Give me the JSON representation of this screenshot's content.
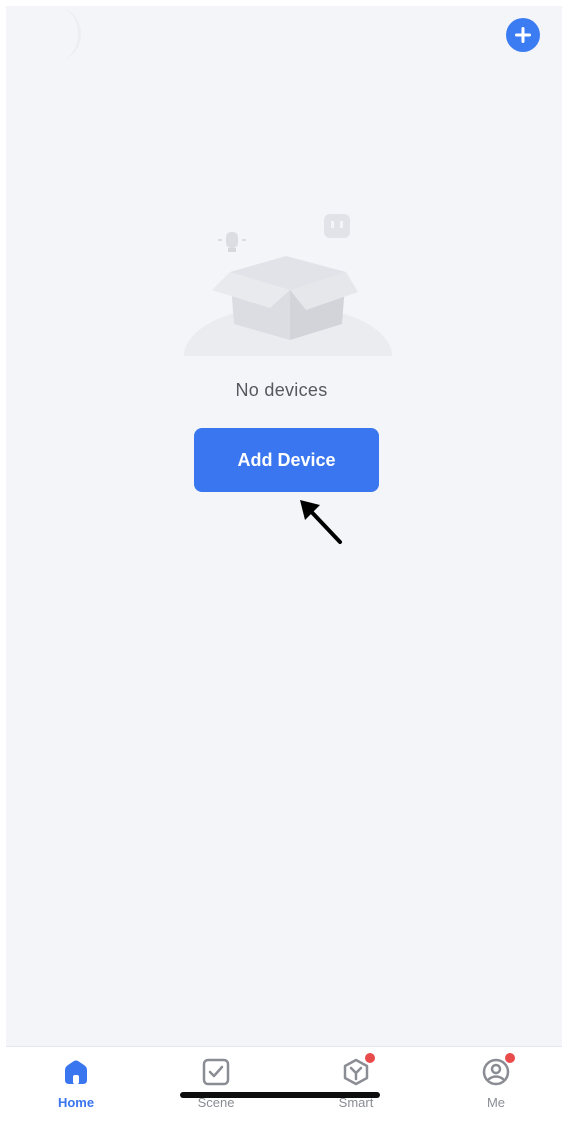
{
  "header": {
    "add_icon": "plus-circle-icon",
    "accent_color": "#3a76ef"
  },
  "empty_state": {
    "illustration_icon": "empty-box-icon",
    "message": "No devices",
    "button_label": "Add Device"
  },
  "annotation": {
    "icon": "arrow-pointer-icon"
  },
  "tabbar": {
    "tabs": [
      {
        "label": "Home",
        "icon": "home-icon",
        "active": true,
        "badge": false
      },
      {
        "label": "Scene",
        "icon": "checkbox-icon",
        "active": false,
        "badge": false
      },
      {
        "label": "Smart",
        "icon": "smart-hex-icon",
        "active": false,
        "badge": true
      },
      {
        "label": "Me",
        "icon": "profile-icon",
        "active": false,
        "badge": true
      }
    ]
  }
}
